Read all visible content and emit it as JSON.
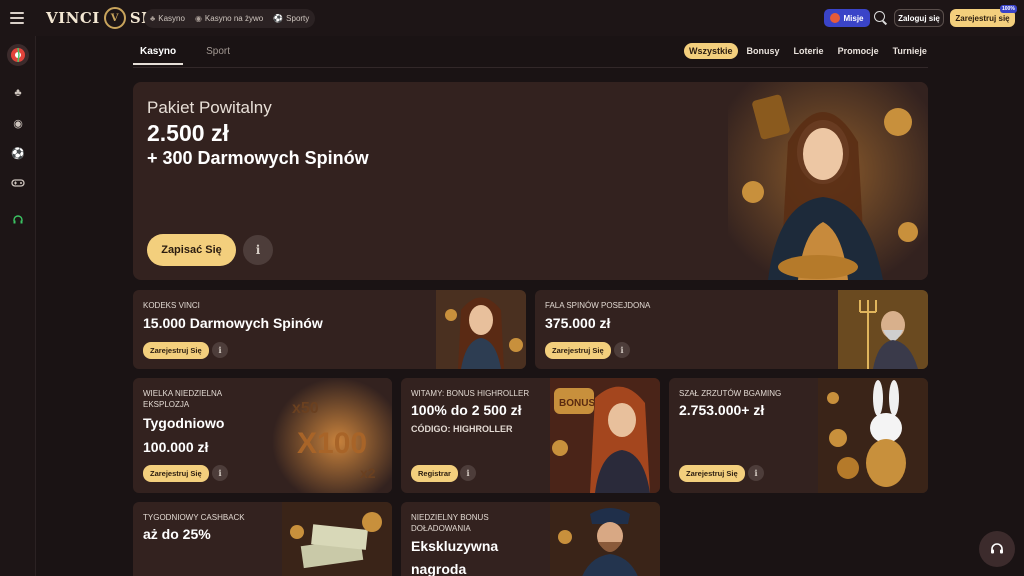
{
  "brand": {
    "name_left": "VINCI",
    "name_right": "SPIN",
    "mark": "V"
  },
  "nav": {
    "items": [
      {
        "label": "Kasyno",
        "icon": "cherries-icon"
      },
      {
        "label": "Kasyno na żywo",
        "icon": "live-icon"
      },
      {
        "label": "Sporty",
        "icon": "soccer-icon"
      }
    ]
  },
  "header": {
    "missions_label": "Misje",
    "login_label": "Zaloguj się",
    "register_label": "Zarejestruj się",
    "register_badge": "100%"
  },
  "tabs": [
    {
      "label": "Kasyno"
    },
    {
      "label": "Sport"
    }
  ],
  "filters": [
    {
      "label": "Wszystkie"
    },
    {
      "label": "Bonusy"
    },
    {
      "label": "Loterie"
    },
    {
      "label": "Promocje"
    },
    {
      "label": "Turnieje"
    }
  ],
  "hero": {
    "subtitle": "Pakiet Powitalny",
    "amount": "2.500 zł",
    "spins": "+ 300 Darmowych Spinów",
    "cta": "Zapisać Się",
    "info": "i"
  },
  "cards": [
    {
      "kicker": "KODEKS VINCI",
      "title": "15.000 Darmowych Spinów",
      "cta": "Zarejestruj Się",
      "info": "i"
    },
    {
      "kicker": "FALA SPINÓW POSEJDONA",
      "title": "375.000 zł",
      "cta": "Zarejestruj Się",
      "info": "i"
    },
    {
      "kicker": "WIELKA NIEDZIELNA EKSPLOZJA",
      "title": "Tygodniowo",
      "title2": "100.000 zł",
      "cta": "Zarejestruj Się",
      "info": "i",
      "art_text": [
        "x50",
        "X100",
        "x2"
      ]
    },
    {
      "kicker": "WITAMY: BONUS HIGHROLLER",
      "title": "100% do 2 500 zł",
      "extra": "CÓDIGO: HIGHROLLER",
      "cta": "Registrar",
      "info": "i",
      "art_text": "BONUS"
    },
    {
      "kicker": "SZAŁ ZRZUTÓW BGAMING",
      "title": "2.753.000+ zł",
      "cta": "Zarejestruj Się",
      "info": "i"
    },
    {
      "kicker": "TYGODNIOWY CASHBACK",
      "title": "aż do 25%"
    },
    {
      "kicker": "NIEDZIELNY BONUS DOŁADOWANIA",
      "title": "Ekskluzywna",
      "title2": "nagroda"
    }
  ],
  "colors": {
    "accent": "#f3cf7d",
    "bg": "#1a1314",
    "card": "#33221f",
    "missions": "#3a44c8"
  }
}
